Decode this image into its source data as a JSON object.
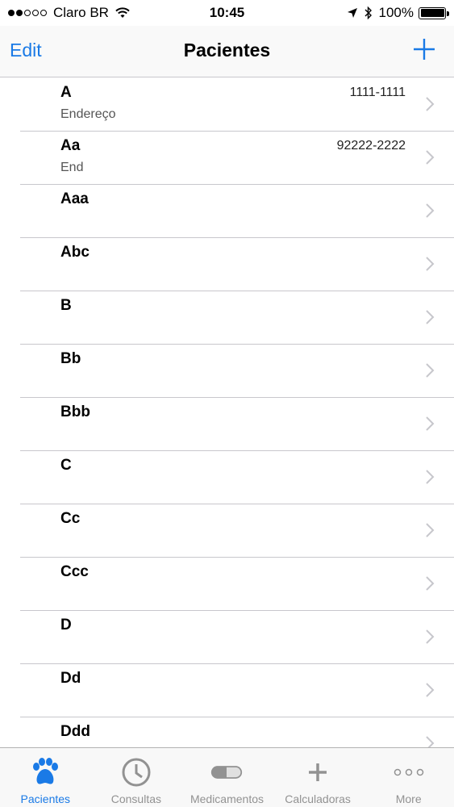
{
  "status_bar": {
    "carrier": "Claro BR",
    "time": "10:45",
    "battery": "100%"
  },
  "nav": {
    "edit_label": "Edit",
    "title": "Pacientes",
    "add_icon": "plus-icon"
  },
  "patients": [
    {
      "name": "A",
      "address": "Endereço",
      "phone": "1111-1111"
    },
    {
      "name": "Aa",
      "address": "End",
      "phone": "92222-2222"
    },
    {
      "name": "Aaa",
      "address": "",
      "phone": ""
    },
    {
      "name": "Abc",
      "address": "",
      "phone": ""
    },
    {
      "name": "B",
      "address": "",
      "phone": ""
    },
    {
      "name": "Bb",
      "address": "",
      "phone": ""
    },
    {
      "name": "Bbb",
      "address": "",
      "phone": ""
    },
    {
      "name": "C",
      "address": "",
      "phone": ""
    },
    {
      "name": "Cc",
      "address": "",
      "phone": ""
    },
    {
      "name": "Ccc",
      "address": "",
      "phone": ""
    },
    {
      "name": "D",
      "address": "",
      "phone": ""
    },
    {
      "name": "Dd",
      "address": "",
      "phone": ""
    },
    {
      "name": "Ddd",
      "address": "",
      "phone": ""
    }
  ],
  "tabs": [
    {
      "label": "Pacientes",
      "icon": "paw-icon",
      "active": true
    },
    {
      "label": "Consultas",
      "icon": "clock-icon",
      "active": false
    },
    {
      "label": "Medicamentos",
      "icon": "pill-icon",
      "active": false
    },
    {
      "label": "Calculadoras",
      "icon": "plus-icon",
      "active": false
    },
    {
      "label": "More",
      "icon": "more-icon",
      "active": false
    }
  ],
  "colors": {
    "accent": "#1a7ae6",
    "inactive": "#929292",
    "separator": "#c8c7cc"
  }
}
